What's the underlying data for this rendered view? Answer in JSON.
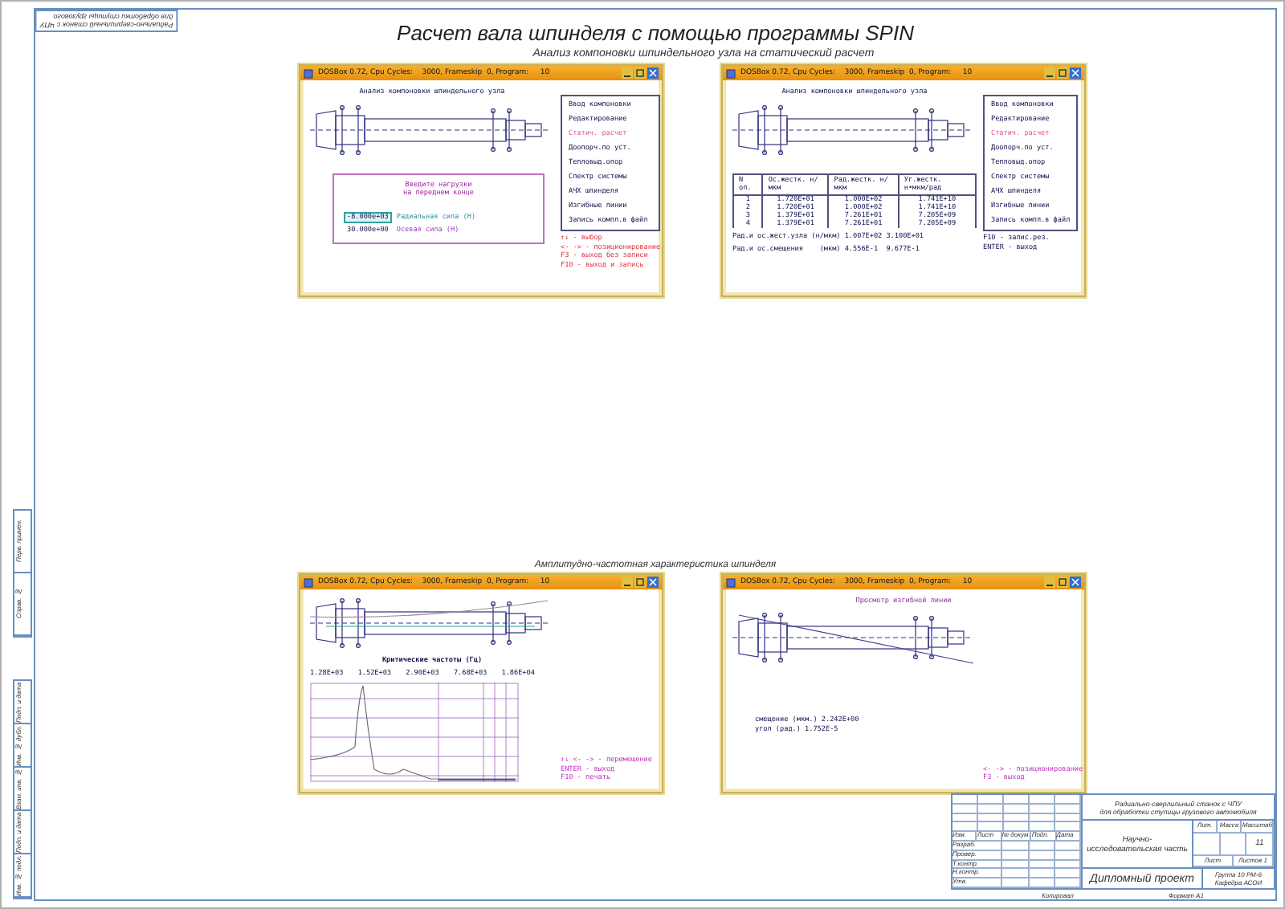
{
  "sheet": {
    "title": "Расчет вала шпинделя с помощью программы SPIN",
    "subtitle": "Анализ компоновки шпиндельного узла на статический расчет",
    "caption": "Амплитудно-частотная характеристика шпинделя",
    "corner_stamp": [
      "Радиально-сверлильный станок с ЧПУ",
      "для обработки ступицы грузового"
    ]
  },
  "windows": [
    {
      "kind": "static_input",
      "title_bar": "DOSBox 0.72, Cpu Cycles:    3000, Frameskip  0, Program:     10",
      "header": "Анализ компоновки шпиндельного узла",
      "menu": [
        {
          "label": "Ввод компоновки",
          "selected": false
        },
        {
          "label": "Редактирование",
          "selected": false
        },
        {
          "label": "Статич. расчет",
          "selected": true
        },
        {
          "label": "Доопорч.по уст.",
          "selected": false
        },
        {
          "label": "Тепловыд.опор",
          "selected": false
        },
        {
          "label": "Спектр системы",
          "selected": false
        },
        {
          "label": "АЧХ шпинделя",
          "selected": false
        },
        {
          "label": "Изгибные линии",
          "selected": false
        },
        {
          "label": "Запись компл.в файл",
          "selected": false
        }
      ],
      "input_panel": {
        "prompt": [
          "Введите нагрузки",
          "на переднем конце"
        ],
        "fields": [
          {
            "value": "-8.000e+03",
            "label": "Радиальная сила (Н)",
            "selected": true
          },
          {
            "value": "30.000e+00",
            "label": "Осевая сила (Н)",
            "selected": false
          }
        ]
      },
      "hints": [
        "↑↓ - выбор",
        "<- -> - позиционирование",
        "F3 - выход без записи",
        "F10 - выход и запись"
      ]
    },
    {
      "kind": "static_result",
      "title_bar": "DOSBox 0.72, Cpu Cycles:    3000, Frameskip  0, Program:     10",
      "header": "Анализ компоновки шпиндельного узла",
      "menu": [
        {
          "label": "Ввод компоновки",
          "selected": false
        },
        {
          "label": "Редактирование",
          "selected": false
        },
        {
          "label": "Статич. расчет",
          "selected": true
        },
        {
          "label": "Доопорч.по уст.",
          "selected": false
        },
        {
          "label": "Тепловыд.опор",
          "selected": false
        },
        {
          "label": "Спектр системы",
          "selected": false
        },
        {
          "label": "АЧХ шпинделя",
          "selected": false
        },
        {
          "label": "Изгибные линии",
          "selected": false
        },
        {
          "label": "Запись компл.в файл",
          "selected": false
        }
      ],
      "table": {
        "columns": [
          "N оп.",
          "Ос.жестк. н/мкм",
          "Рад.жестк. н/мкм",
          "Уг.жестк. н•мкм/рад"
        ],
        "rows": [
          [
            "1",
            "1.720E+01",
            "1.000E+02",
            "1.741E+10"
          ],
          [
            "2",
            "1.720E+01",
            "1.000E+02",
            "1.741E+10"
          ],
          [
            "3",
            "1.379E+01",
            "7.261E+01",
            "7.205E+09"
          ],
          [
            "4",
            "1.379E+01",
            "7.261E+01",
            "7.205E+09"
          ]
        ]
      },
      "summary": [
        "Рад.и ос.жест.узла (н/мкм) 1.007E+02 3.100E+01",
        "Рад.и ос.смещения    (мкм) 4.556E-1  9.677E-1"
      ],
      "hints": [
        "F10 - запис.рез.",
        "ENTER - выход"
      ]
    },
    {
      "kind": "afc",
      "title_bar": "DOSBox 0.72, Cpu Cycles:    3000, Frameskip  0, Program:     10",
      "chart_caption": "Критические частоты (Гц)",
      "freq_labels": [
        "1.28E+03",
        "1.52E+03",
        "2.90E+03",
        "7.68E+03",
        "1.86E+04"
      ],
      "hints": [
        "↑↓ <- -> - перемещение",
        "ENTER - выход",
        "F10 - печать"
      ]
    },
    {
      "kind": "bending",
      "title_bar": "DOSBox 0.72, Cpu Cycles:    3000, Frameskip  0, Program:     10",
      "header": "Просмотр изгибной линии",
      "readouts": [
        "смещение (мкм.)  2.242E+00",
        "угол (рад.)  1.752E-5"
      ],
      "hints": [
        "<- -> - позиционирование",
        "F3 - выход"
      ]
    }
  ],
  "title_block": {
    "designation": [
      "Радиально-сверлильный станок с ЧПУ",
      "для обработки ступицы грузового автомобиля"
    ],
    "headers": [
      "Изм.",
      "Лист",
      "№ докум.",
      "Подп.",
      "Дата"
    ],
    "roles": [
      "Разраб.",
      "Провер.",
      "Т.контр.",
      "Н.контр.",
      "Утв."
    ],
    "part_name": "Научно-исследовательская часть",
    "lit_headers": [
      "Лит.",
      "Масса",
      "Масштаб"
    ],
    "scale": "11",
    "sheet_labels": [
      "Лист",
      "Листов 1"
    ],
    "doc_type": "Дипломный проект",
    "org": [
      "Группа 10 РМ-6",
      "Кафедра АСОИ"
    ],
    "footer": [
      "Копировал",
      "Формат А1"
    ]
  },
  "margin_stamps": [
    {
      "labels": [
        "Перв. примен.",
        "Справ. №"
      ]
    },
    {
      "labels": [
        "Подп. и дата",
        "Инв. № дубл.",
        "Взам. инв. №",
        "Подп. и дата",
        "Инв. № подл."
      ]
    }
  ]
}
